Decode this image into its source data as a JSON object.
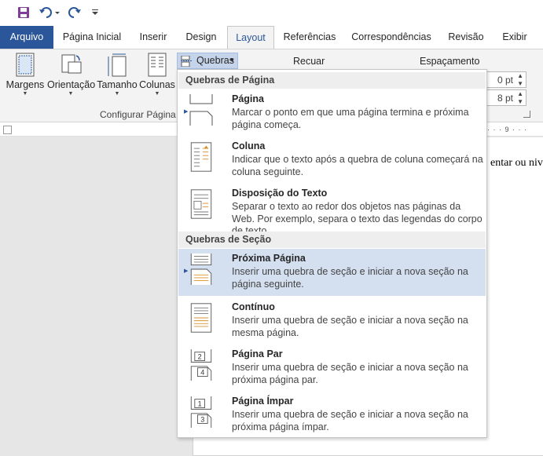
{
  "quick_access": {
    "save_icon": "save-icon",
    "undo_icon": "undo-icon",
    "redo_icon": "redo-icon",
    "customize_icon": "customize-qat-icon"
  },
  "tabs": [
    {
      "label": "Arquivo"
    },
    {
      "label": "Página Inicial"
    },
    {
      "label": "Inserir"
    },
    {
      "label": "Design"
    },
    {
      "label": "Layout"
    },
    {
      "label": "Referências"
    },
    {
      "label": "Correspondências"
    },
    {
      "label": "Revisão"
    },
    {
      "label": "Exibir"
    }
  ],
  "ribbon": {
    "margins_label": "Margens",
    "orientation_label": "Orientação",
    "size_label": "Tamanho",
    "columns_label": "Colunas",
    "breaks_label": "Quebras",
    "group_label": "Configurar Página",
    "indent_label": "Recuar",
    "spacing_label": "Espaçamento",
    "spacing_before": "0 pt",
    "spacing_after": "8 pt"
  },
  "ruler": {
    "marks": "· · · 9 · · ·"
  },
  "document": {
    "text": "entar ou niv"
  },
  "menu": {
    "page_breaks_header": "Quebras de Página",
    "section_breaks_header": "Quebras de Seção",
    "items": [
      {
        "title": "Página",
        "desc": "Marcar o ponto em que uma página termina e próxima página começa."
      },
      {
        "title": "Coluna",
        "desc": "Indicar que o texto após a quebra de coluna começará na coluna seguinte."
      },
      {
        "title": "Disposição do Texto",
        "desc": "Separar o texto ao redor dos objetos nas páginas da Web. Por exemplo, separa o texto das legendas do corpo de texto."
      },
      {
        "title": "Próxima Página",
        "desc": "Inserir uma quebra de seção e iniciar a nova seção na página seguinte."
      },
      {
        "title": "Contínuo",
        "desc": "Inserir uma quebra de seção e iniciar a nova seção na mesma página."
      },
      {
        "title": "Página Par",
        "desc": "Inserir uma quebra de seção e iniciar a nova seção na próxima página par."
      },
      {
        "title": "Página Ímpar",
        "desc": "Inserir uma quebra de seção e iniciar a nova seção na próxima página ímpar."
      }
    ],
    "highlighted_item": "Próxima Página",
    "even_number": "2",
    "even_next": "4",
    "odd_number": "1",
    "odd_next": "3"
  },
  "colors": {
    "accent": "#2b579a",
    "highlight": "#d4dff0"
  }
}
